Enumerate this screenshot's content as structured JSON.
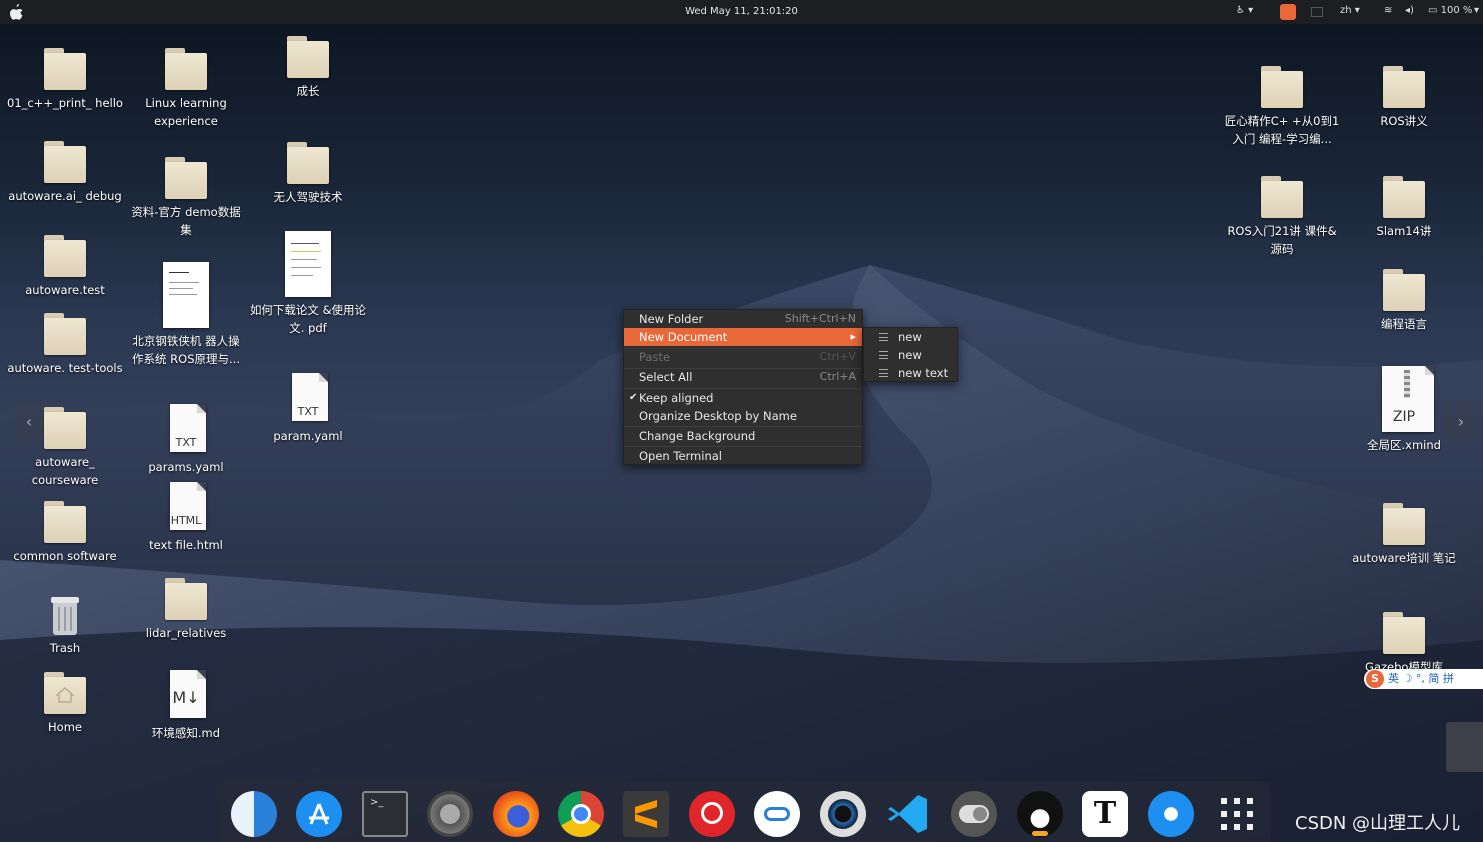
{
  "topbar": {
    "clock": "Wed May 11, 21:01:20",
    "lang": "zh",
    "battery": "100 %"
  },
  "desktop": {
    "icons_left": [
      {
        "label": "01_c++_print_ hello",
        "kind": "folder"
      },
      {
        "label": "autoware.ai_ debug",
        "kind": "folder"
      },
      {
        "label": "autoware.test",
        "kind": "folder"
      },
      {
        "label": "autoware. test-tools",
        "kind": "folder"
      },
      {
        "label": "autoware_ courseware",
        "kind": "folder"
      },
      {
        "label": "common software",
        "kind": "folder"
      },
      {
        "label": "Trash",
        "kind": "trash"
      },
      {
        "label": "Home",
        "kind": "home"
      }
    ],
    "icons_col2": [
      {
        "label": "Linux learning experience",
        "kind": "folder"
      },
      {
        "label": "资料-官方 demo数据集",
        "kind": "folder"
      },
      {
        "label": "北京钢铁侠机 器人操作系统 ROS原理与...",
        "kind": "pdf"
      },
      {
        "label": "params.yaml",
        "kind": "doc",
        "tag": "TXT"
      },
      {
        "label": "text file.html",
        "kind": "doc",
        "tag": "HTML"
      },
      {
        "label": "lidar_relatives",
        "kind": "folder"
      },
      {
        "label": "环境感知.md",
        "kind": "doc",
        "tag": "M↓"
      }
    ],
    "icons_col3": [
      {
        "label": "成长",
        "kind": "folder"
      },
      {
        "label": "无人驾驶技术",
        "kind": "folder"
      },
      {
        "label": "如何下载论文 &使用论文. pdf",
        "kind": "pdf"
      },
      {
        "label": "param.yaml",
        "kind": "doc",
        "tag": "TXT"
      }
    ],
    "icons_right_a": [
      {
        "label": "匠心精作C+ +从0到1入门 编程-学习编...",
        "kind": "folder"
      },
      {
        "label": "ROS入门21讲 课件&源码",
        "kind": "folder"
      }
    ],
    "icons_right_b": [
      {
        "label": "ROS讲义",
        "kind": "folder"
      },
      {
        "label": "Slam14讲",
        "kind": "folder"
      },
      {
        "label": "编程语言",
        "kind": "folder"
      },
      {
        "label": "全局区.xmind",
        "kind": "zip",
        "tag": "ZIP"
      },
      {
        "label": "autoware培训 笔记",
        "kind": "folder"
      },
      {
        "label": "Gazebo模型库",
        "kind": "folder"
      }
    ]
  },
  "context_menu": {
    "items": [
      {
        "label": "New Folder",
        "accel": "Shift+Ctrl+N"
      },
      {
        "label": "New Document",
        "accel": ""
      },
      {
        "label": "Paste",
        "accel": "Ctrl+V"
      },
      {
        "label": "Select All",
        "accel": "Ctrl+A"
      },
      {
        "label": "Keep aligned",
        "accel": ""
      },
      {
        "label": "Organize Desktop by Name",
        "accel": ""
      },
      {
        "label": "Change Background",
        "accel": ""
      },
      {
        "label": "Open Terminal",
        "accel": ""
      }
    ],
    "checkmark": "✔"
  },
  "submenu": {
    "items": [
      "new",
      "new",
      "new text"
    ]
  },
  "ime": {
    "text": "英 ☽ °, 简 拼"
  },
  "dock": {
    "apps": [
      "finder",
      "app-store",
      "terminal",
      "settings",
      "firefox",
      "chrome",
      "sublime-text",
      "netease-music",
      "baidu-netdisk",
      "camera",
      "vscode",
      "toggle",
      "qq",
      "typora",
      "xunlei",
      "app-grid"
    ]
  },
  "watermark": "CSDN @山理工人儿",
  "colors": {
    "highlight": "#e9683a"
  }
}
